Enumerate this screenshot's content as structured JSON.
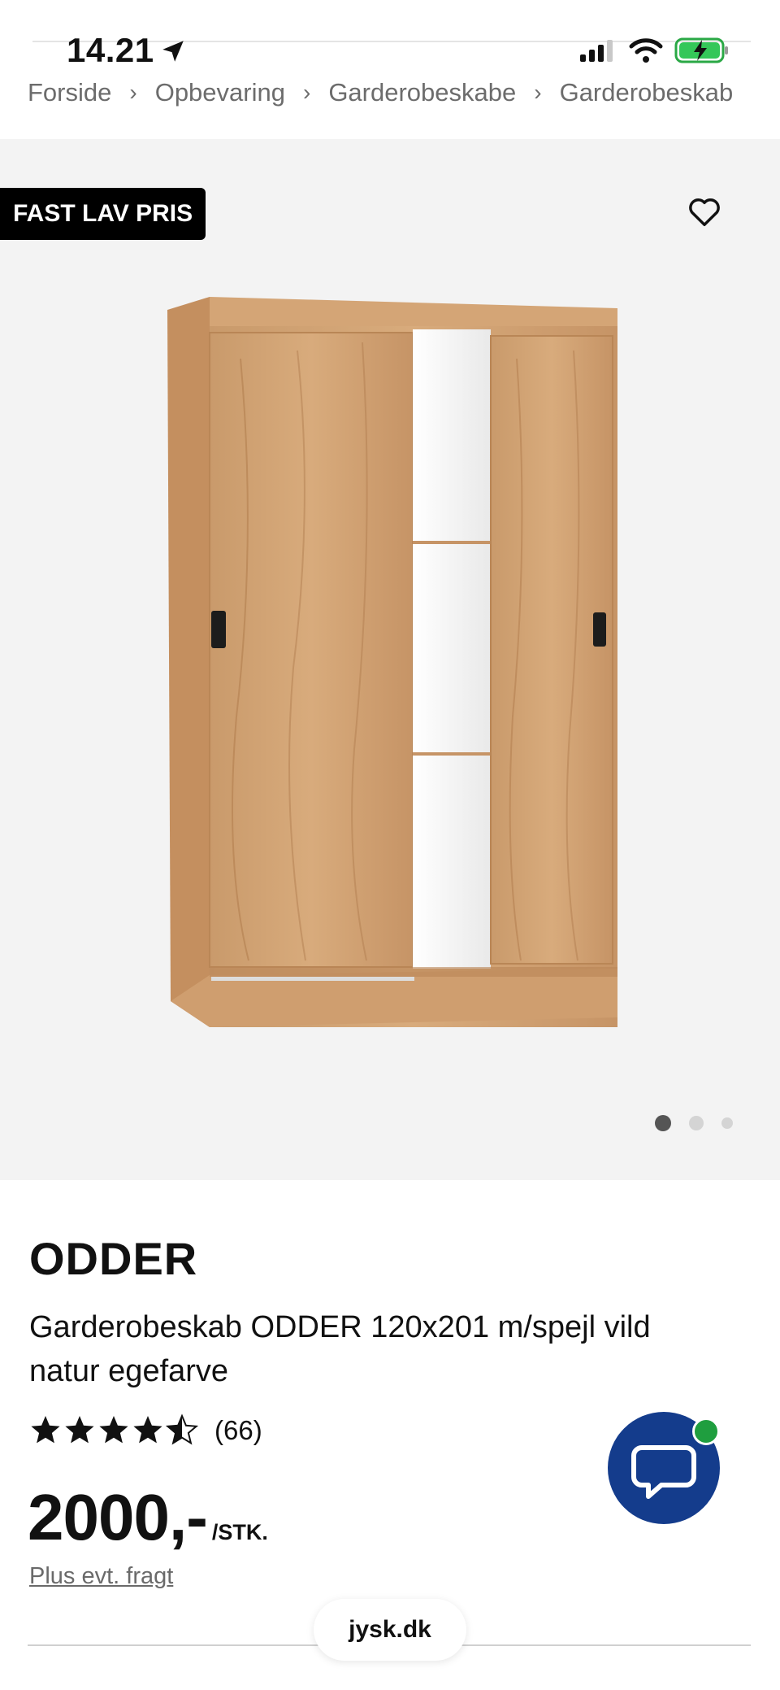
{
  "status_bar": {
    "time": "14.21",
    "icons": [
      "location-arrow-icon",
      "signal-icon",
      "wifi-icon",
      "battery-charging-icon"
    ]
  },
  "breadcrumb": {
    "items": [
      "Forside",
      "Opbevaring",
      "Garderobeskabe",
      "Garderobeskab"
    ],
    "separator_icon": "chevron-right-icon"
  },
  "hero": {
    "badge": "FAST LAV PRIS",
    "favorite_icon": "heart-outline-icon",
    "image_dots": {
      "count": 3,
      "active_index": 0
    }
  },
  "product": {
    "brand": "ODDER",
    "description": "Garderobeskab ODDER 120x201 m/spejl vild natur egefarve",
    "rating": {
      "stars": 4.5,
      "max": 5,
      "count_label": "(66)"
    },
    "price": "2000,-",
    "unit": "/STK.",
    "shipping_note": "Plus evt. fragt"
  },
  "chat": {
    "icon": "chat-bubble-icon",
    "status_color": "#1f9e3f",
    "button_color": "#143c8c"
  },
  "browser": {
    "url": "jysk.dk"
  }
}
